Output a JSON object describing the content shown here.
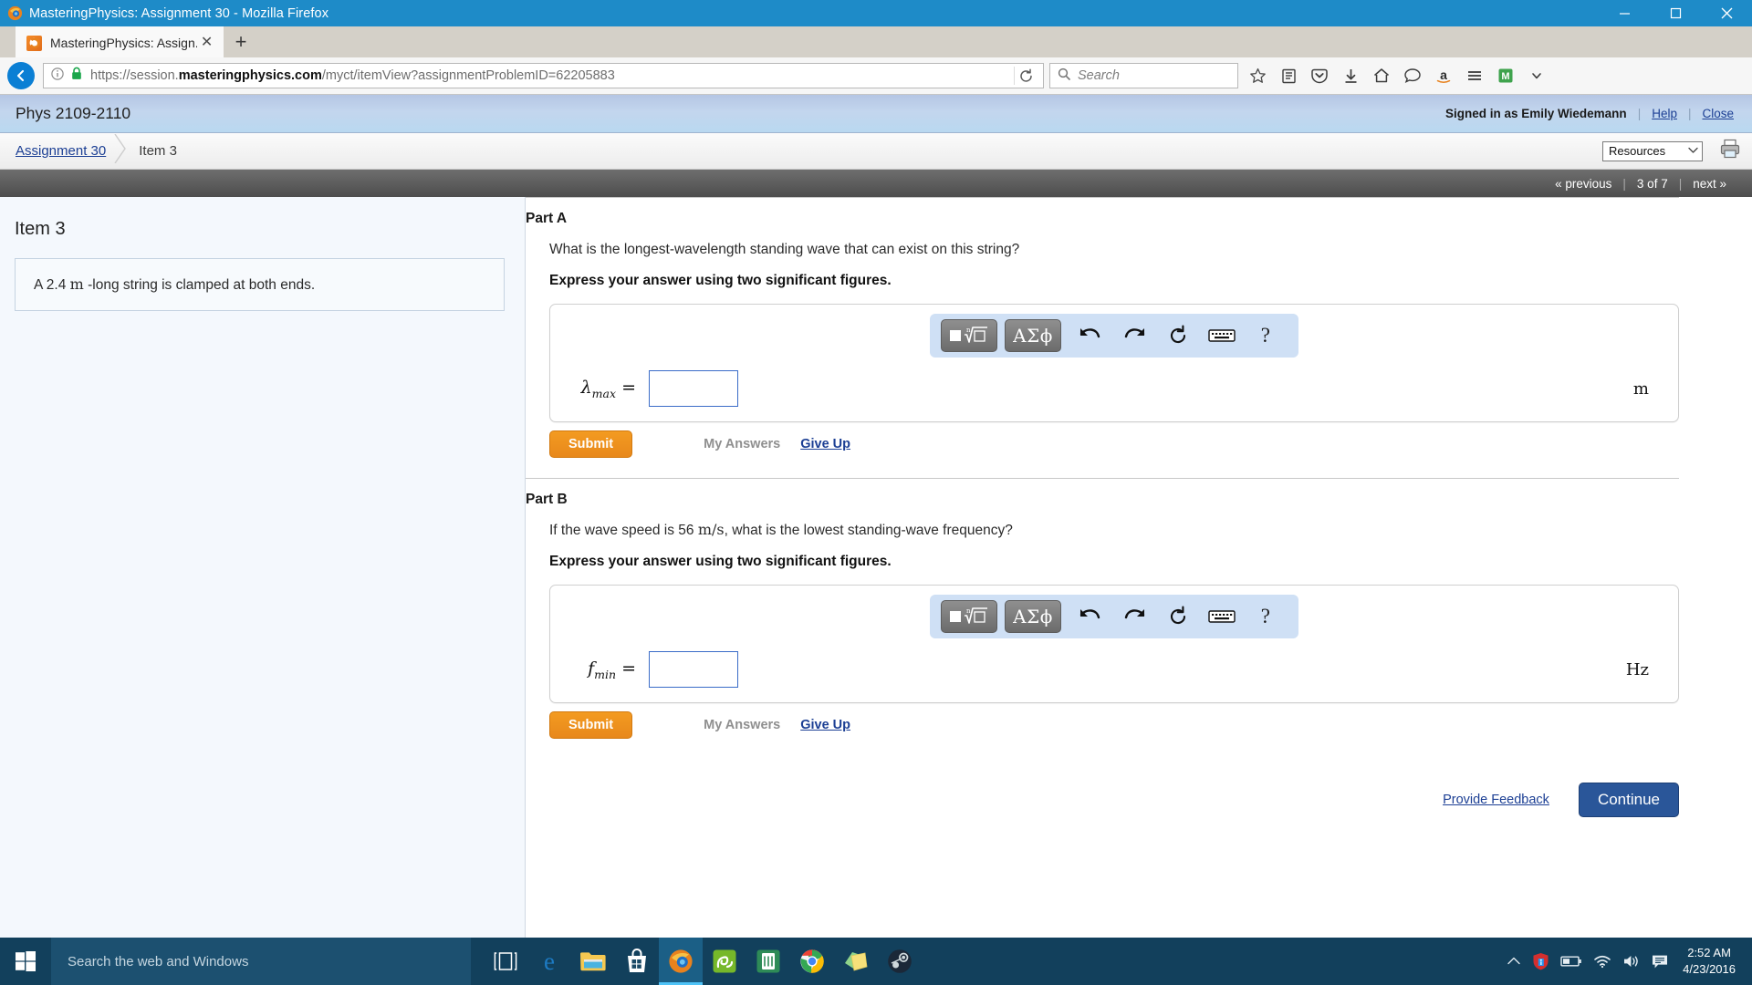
{
  "browser": {
    "window_title": "MasteringPhysics: Assignment 30 - Mozilla Firefox",
    "tab_label": "MasteringPhysics: Assign...",
    "tab_close_glyph": "✕",
    "newtab_glyph": "+",
    "url_prefix": "https://session.",
    "url_domain": "masteringphysics.com",
    "url_path": "/myct/itemView?assignmentProblemID=62205883",
    "search_placeholder": "Search",
    "minimize_glyph": "─",
    "maximize_glyph": "❐",
    "close_glyph": "✕"
  },
  "mp_header": {
    "course_title": "Phys 2109-2110",
    "signed_in_as": "Signed in as Emily Wiedemann",
    "help_label": "Help",
    "close_label": "Close",
    "separator": "|"
  },
  "breadcrumb": {
    "assignment_link": "Assignment 30",
    "current_item": "Item 3",
    "resources_label": "Resources",
    "caret_glyph": "⌄"
  },
  "pager": {
    "previous_label": "« previous",
    "position_label": "3 of 7",
    "next_label": "next »",
    "separator": "|"
  },
  "left_pane": {
    "item_title": "Item 3",
    "problem_pre": "A 2.4 ",
    "problem_unit": "m",
    "problem_post": " -long string is clamped at both ends."
  },
  "parts": [
    {
      "title": "Part A",
      "question_pre": "What is the longest-wavelength standing wave that can exist on this string?",
      "question_unit": "",
      "question_post": "",
      "instruction": "Express your answer using two significant figures.",
      "math_button_greek": "ΑΣϕ",
      "help_glyph": "?",
      "variable_symbol": "λ",
      "variable_sub": "max",
      "equals": "=",
      "input_value": "",
      "unit": "m",
      "submit_label": "Submit",
      "my_answers_label": "My Answers",
      "give_up_label": "Give Up"
    },
    {
      "title": "Part B",
      "question_pre": "If the wave speed is 56 ",
      "question_unit": "m/s",
      "question_post": ", what is the lowest standing-wave frequency?",
      "instruction": "Express your answer using two significant figures.",
      "math_button_greek": "ΑΣϕ",
      "help_glyph": "?",
      "variable_symbol": "f",
      "variable_sub": "min",
      "equals": "=",
      "input_value": "",
      "unit": "Hz",
      "submit_label": "Submit",
      "my_answers_label": "My Answers",
      "give_up_label": "Give Up"
    }
  ],
  "footer": {
    "feedback_label": "Provide Feedback",
    "continue_label": "Continue"
  },
  "taskbar": {
    "search_placeholder": "Search the web and Windows",
    "time": "2:52 AM",
    "date": "4/23/2016"
  },
  "colors": {
    "titlebar_blue": "#1e8bc8",
    "submit_orange": "#f39b21",
    "continue_blue": "#2a5699",
    "link_blue": "#1c3f94",
    "math_toolbar_blue": "#cfe0f5",
    "taskbar_navy": "#12405c"
  }
}
